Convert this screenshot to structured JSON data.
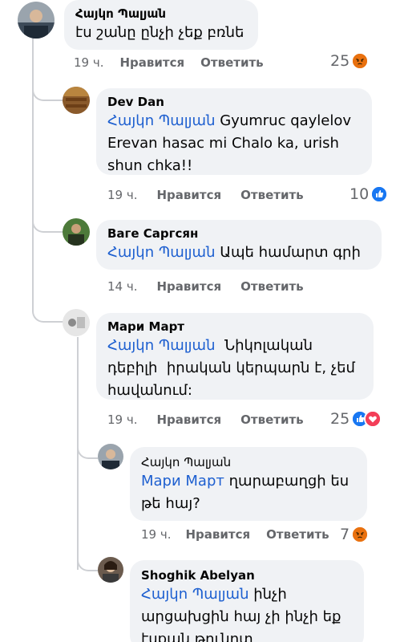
{
  "colors": {
    "mention": "#1d5fd0",
    "meta": "#65676b",
    "bubble": "#f0f2f5",
    "like": "#1877f2",
    "love": "#f33e58",
    "angry": "#e9710f"
  },
  "comments": [
    {
      "author": "Հայկո Պալյան",
      "text": "էս շանը ընչի չեք բռնե",
      "time": "19 ч.",
      "like_label": "Нравится",
      "reply_label": "Ответить",
      "reaction_count": "25",
      "reactions": [
        "angry-icon"
      ]
    },
    {
      "author": "Dev Dan",
      "mention": "Հայկո Պալյան",
      "text_line1": " Gyumruc qaylelov",
      "text_line2": "Erevan hasac mi Chalo ka, urish",
      "text_line3": "shun chka!!",
      "time": "19 ч.",
      "like_label": "Нравится",
      "reply_label": "Ответить",
      "reaction_count": "10",
      "reactions": [
        "like-icon"
      ]
    },
    {
      "author": "Ваге Саргсян",
      "mention": "Հայկո Պալյան",
      "text": " Ապե համարտ գրի",
      "time": "14 ч.",
      "like_label": "Нравится",
      "reply_label": "Ответить"
    },
    {
      "author": "Мари Март",
      "mention": "Հայկո Պալյան",
      "text_line1": "  Նիկոլական",
      "text_line2": "դեբիլի  իրական կերպարն է, չեմ",
      "text_line3": "հավանում:",
      "time": "19 ч.",
      "like_label": "Нравится",
      "reply_label": "Ответить",
      "reaction_count": "25",
      "reactions": [
        "like-icon",
        "love-icon"
      ]
    },
    {
      "author": "Հայկո Պալյան",
      "mention": "Мари Март",
      "text_line1": " ղարաբաղցի ես",
      "text_line2": "թե հայ?",
      "time": "19 ч.",
      "like_label": "Нравится",
      "reply_label": "Ответить",
      "reaction_count": "7",
      "reactions": [
        "angry-icon"
      ]
    },
    {
      "author": "Shoghik Abelyan",
      "mention": "Հայկո Պալյան",
      "text_line1": " ինչի",
      "text_line2": "արցախցին հայ չի ինչի եք",
      "text_line3": "էսքան թունոտ"
    }
  ]
}
